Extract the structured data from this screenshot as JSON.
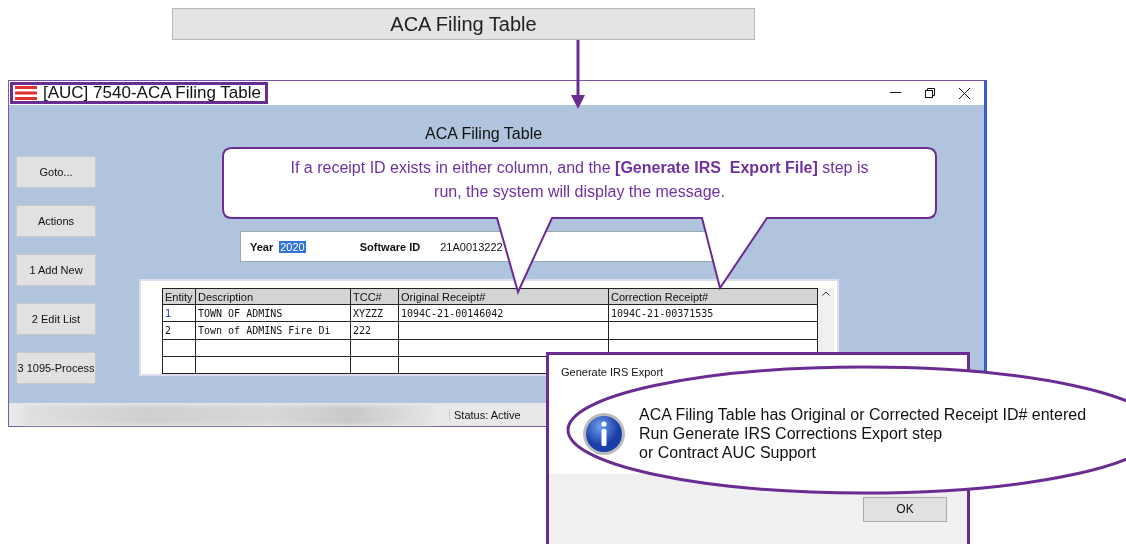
{
  "banner": {
    "title": "ACA Filing Table"
  },
  "window": {
    "title": "[AUC] 7540-ACA Filing Table",
    "heading": "ACA Filing Table"
  },
  "side_buttons": [
    "Goto...",
    "Actions",
    "1 Add New",
    "2 Edit List",
    "3 1095-Process"
  ],
  "year": {
    "label": "Year",
    "value": "2020",
    "selected": true
  },
  "software": {
    "label": "Software ID",
    "value": "21A0013222"
  },
  "table": {
    "columns": [
      "Entity",
      "Description",
      "TCC#",
      "Original Receipt#",
      "Correction Receipt#"
    ],
    "rows": [
      {
        "selected": true,
        "cells": [
          "1",
          "TOWN OF ADMINS",
          "XYZZZ",
          "1094C-21-00146042",
          "1094C-21-00371535"
        ]
      },
      {
        "selected": false,
        "cells": [
          "2",
          "Town of ADMINS Fire Di",
          "222",
          "",
          ""
        ]
      }
    ]
  },
  "callout": {
    "text": "If a receipt ID exists in either column, and the **[Generate IRS  Export File]** step is run, the system will display the message."
  },
  "status_bar": {
    "status": "Status: Active"
  },
  "dialog": {
    "title": "Generate IRS Export",
    "message": [
      "ACA Filing Table has Original or Corrected Receipt ID# entered",
      "Run Generate IRS Corrections Export step",
      "or Contract AUC Support"
    ],
    "buttons": [
      "OK"
    ]
  }
}
